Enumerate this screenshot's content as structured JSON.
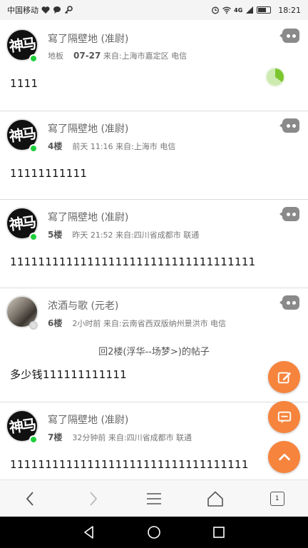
{
  "status_bar": {
    "carrier": "中国移动",
    "network": "4G",
    "time": "18:21"
  },
  "posts": [
    {
      "username": "寫了隔壁地",
      "role": "(准尉)",
      "floor": "地板",
      "time": "07-27",
      "source": "来自:上海市嘉定区 电信",
      "content": "1111",
      "avatar_text": "神马"
    },
    {
      "username": "寫了隔壁地",
      "role": "(准尉)",
      "floor": "4楼",
      "time": "前天 11:16",
      "source": "来自:上海市 电信",
      "content": "11111111111",
      "avatar_text": "神马"
    },
    {
      "username": "寫了隔壁地",
      "role": "(准尉)",
      "floor": "5楼",
      "time": "昨天 21:52",
      "source": "来自:四川省成都市 联通",
      "content": "11111111111111111111111111111111111",
      "avatar_text": "神马"
    },
    {
      "username": "浓酒与歌",
      "role": "(元老)",
      "floor": "6楼",
      "time": "2小时前",
      "source": "来自:云南省西双版纳州景洪市 电信",
      "quote": "回2楼(浮华--场梦>)的帖子",
      "content": "多少钱111111111111"
    },
    {
      "username": "寫了隔壁地",
      "role": "(准尉)",
      "floor": "7楼",
      "time": "32分钟前",
      "source": "来自:四川省成都市 联通",
      "content": "1111111111111111111111111111111111",
      "avatar_text": "神马"
    }
  ],
  "toolbar": {
    "tab_count": "1"
  },
  "colors": {
    "accent": "#f6843d",
    "online": "#1fcf3b",
    "reply_button": "#8a8a8a"
  },
  "icons": [
    "heart-icon",
    "chat-icon",
    "key-icon",
    "alarm-icon",
    "wifi-icon",
    "signal-icon",
    "battery-icon",
    "reply-icon",
    "edit-icon",
    "comment-icon",
    "scroll-top-icon",
    "back-icon",
    "forward-icon",
    "menu-icon",
    "home-icon",
    "tabs-icon"
  ]
}
